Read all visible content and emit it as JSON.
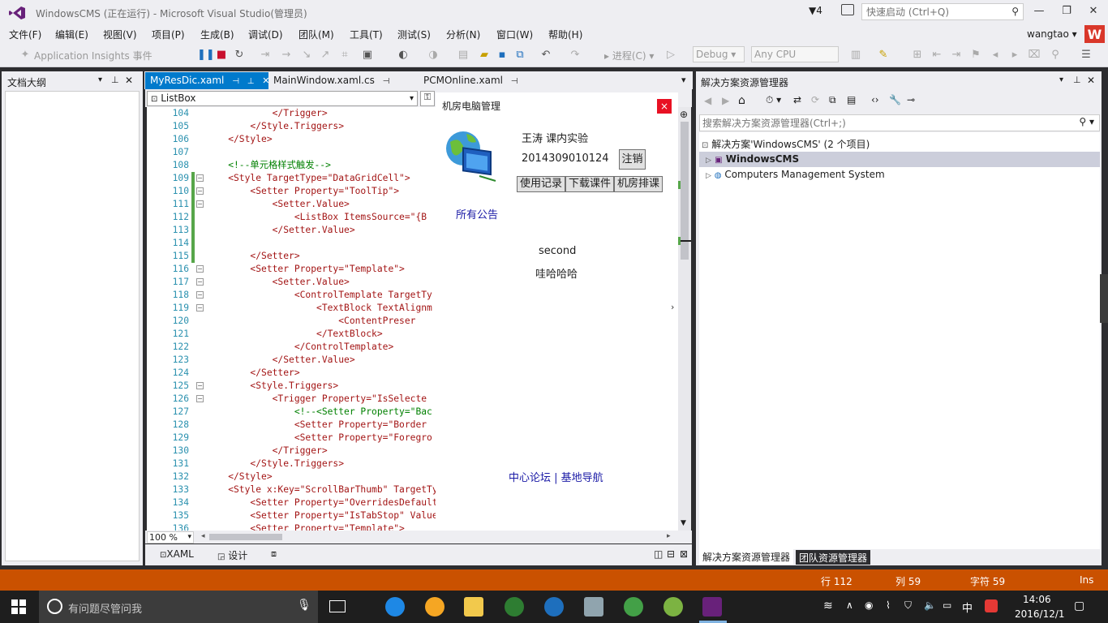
{
  "window": {
    "title": "WindowsCMS (正在运行) - Microsoft Visual Studio(管理员)",
    "notifications": "4",
    "quick_launch_placeholder": "快速启动 (Ctrl+Q)",
    "user": "wangtao",
    "user_badge": "W"
  },
  "menu": [
    "文件(F)",
    "编辑(E)",
    "视图(V)",
    "项目(P)",
    "生成(B)",
    "调试(D)",
    "团队(M)",
    "工具(T)",
    "测试(S)",
    "分析(N)",
    "窗口(W)",
    "帮助(H)"
  ],
  "toolbar": {
    "insights": "Application Insights 事件",
    "step": "进程(C)",
    "config": "Debug",
    "platform": "Any CPU"
  },
  "outline": {
    "title": "文档大纲"
  },
  "editor": {
    "tabs": [
      {
        "label": "MyResDic.xaml",
        "active": true
      },
      {
        "label": "MainWindow.xaml.cs",
        "active": false
      },
      {
        "label": "PCMOnline.xaml",
        "active": false
      }
    ],
    "nav_dropdown": "ListBox",
    "zoom": "100 %",
    "view_tabs": [
      "XAML",
      "设计"
    ],
    "lines": [
      {
        "n": "104",
        "text": "            </Trigger>"
      },
      {
        "n": "105",
        "text": "        </Style.Triggers>"
      },
      {
        "n": "106",
        "text": "    </Style>"
      },
      {
        "n": "107",
        "text": ""
      },
      {
        "n": "108",
        "text": "    <!--单元格样式触发-->"
      },
      {
        "n": "109",
        "text": "    <Style TargetType=\"DataGridCell\">"
      },
      {
        "n": "110",
        "text": "        <Setter Property=\"ToolTip\">"
      },
      {
        "n": "111",
        "text": "            <Setter.Value>"
      },
      {
        "n": "112",
        "text": "                <ListBox ItemsSource=\"{B"
      },
      {
        "n": "113",
        "text": "            </Setter.Value>"
      },
      {
        "n": "114",
        "text": ""
      },
      {
        "n": "115",
        "text": "        </Setter>"
      },
      {
        "n": "116",
        "text": "        <Setter Property=\"Template\">"
      },
      {
        "n": "117",
        "text": "            <Setter.Value>"
      },
      {
        "n": "118",
        "text": "                <ControlTemplate TargetTy"
      },
      {
        "n": "119",
        "text": "                    <TextBlock TextAlignm"
      },
      {
        "n": "120",
        "text": "                        <ContentPreser"
      },
      {
        "n": "121",
        "text": "                    </TextBlock>"
      },
      {
        "n": "122",
        "text": "                </ControlTemplate>"
      },
      {
        "n": "123",
        "text": "            </Setter.Value>"
      },
      {
        "n": "124",
        "text": "        </Setter>"
      },
      {
        "n": "125",
        "text": "        <Style.Triggers>"
      },
      {
        "n": "126",
        "text": "            <Trigger Property=\"IsSelecte"
      },
      {
        "n": "127",
        "text": "                <!--<Setter Property=\"Bac"
      },
      {
        "n": "128",
        "text": "                <Setter Property=\"Border"
      },
      {
        "n": "129",
        "text": "                <Setter Property=\"Foregro"
      },
      {
        "n": "130",
        "text": "            </Trigger>"
      },
      {
        "n": "131",
        "text": "        </Style.Triggers>"
      },
      {
        "n": "132",
        "text": "    </Style>"
      },
      {
        "n": "133",
        "text": "    <Style x:Key=\"ScrollBarThumb\" TargetType=\"{x:Type Thumb}\">"
      },
      {
        "n": "134",
        "text": "        <Setter Property=\"OverridesDefaultStyle\" Value=\"true\"/>"
      },
      {
        "n": "135",
        "text": "        <Setter Property=\"IsTabStop\" Value=\"false\"/>"
      },
      {
        "n": "136",
        "text": "        <Setter Property=\"Template\">"
      }
    ]
  },
  "app": {
    "title": "机房电脑管理",
    "close": "×",
    "user_line": "王涛   课内实验",
    "student_id": "2014309010124",
    "logout": "注销",
    "buttons": [
      "使用记录",
      "下载课件",
      "机房排课"
    ],
    "notice": "所有公告",
    "line1": "second",
    "line2": "哇哈哈哈",
    "links": "中心论坛 | 基地导航"
  },
  "solution_explorer": {
    "title": "解决方案资源管理器",
    "search_placeholder": "搜索解决方案资源管理器(Ctrl+;)",
    "tree": [
      {
        "label": "解决方案'WindowsCMS' (2 个项目)",
        "selected": false
      },
      {
        "label": "WindowsCMS",
        "selected": true
      },
      {
        "label": "Computers Management System",
        "selected": false
      }
    ],
    "bottom_tabs": [
      "解决方案资源管理器",
      "团队资源管理器"
    ]
  },
  "status": {
    "line": "行 112",
    "col": "列 59",
    "ch": "字符 59",
    "mode": "Ins"
  },
  "taskbar": {
    "search_placeholder": "有问题尽管问我",
    "time": "14:06",
    "date": "2016/12/1",
    "ime": "中"
  },
  "colors": {
    "accent": "#007acc",
    "status_bar": "#ca5100",
    "brand": "#68217a"
  }
}
